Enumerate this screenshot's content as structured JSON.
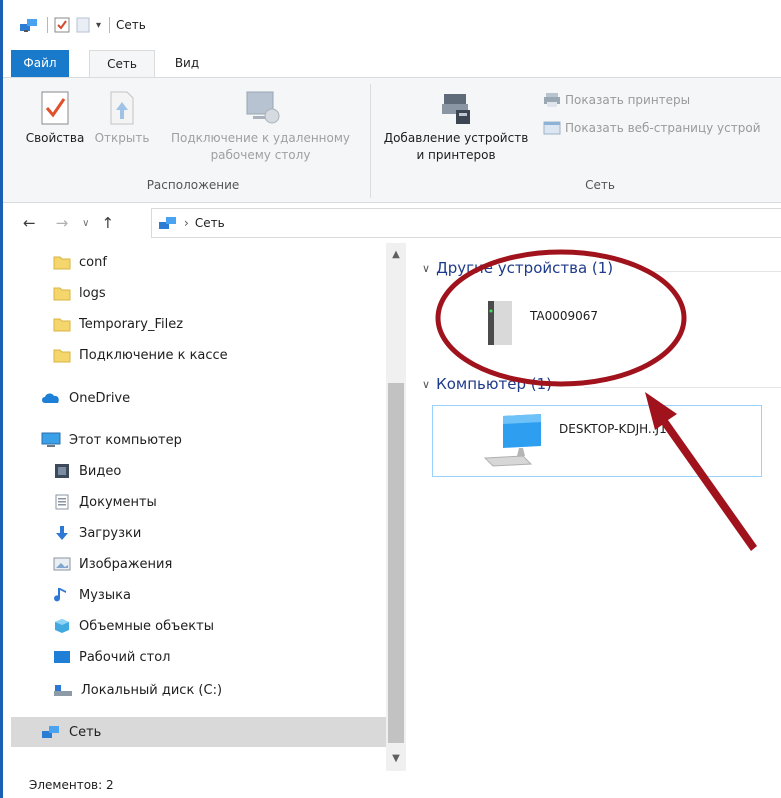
{
  "window": {
    "title": "Сеть"
  },
  "tabs": {
    "file": "Файл",
    "network": "Сеть",
    "view": "Вид"
  },
  "ribbon": {
    "properties": "Свойства",
    "open": "Открыть",
    "remote_line1": "Подключение к удаленному",
    "remote_line2": "рабочему столу",
    "location_group": "Расположение",
    "add_devices_line1": "Добавление устройств",
    "add_devices_line2": "и принтеров",
    "show_printers": "Показать принтеры",
    "show_webpage": "Показать веб-страницу устрой",
    "network_group": "Сеть"
  },
  "address": {
    "crumb": "Сеть"
  },
  "nav": {
    "items": [
      {
        "label": "conf",
        "icon": "folder-icon"
      },
      {
        "label": "logs",
        "icon": "folder-icon"
      },
      {
        "label": "Temporary_Filez",
        "icon": "folder-icon"
      },
      {
        "label": "Подключение к кассе",
        "icon": "folder-icon"
      },
      {
        "label": "OneDrive",
        "icon": "cloud-icon"
      },
      {
        "label": "Этот компьютер",
        "icon": "computer-icon"
      },
      {
        "label": "Видео",
        "icon": "video-icon"
      },
      {
        "label": "Документы",
        "icon": "documents-icon"
      },
      {
        "label": "Загрузки",
        "icon": "download-icon"
      },
      {
        "label": "Изображения",
        "icon": "pictures-icon"
      },
      {
        "label": "Музыка",
        "icon": "music-icon"
      },
      {
        "label": "Объемные объекты",
        "icon": "3d-objects-icon"
      },
      {
        "label": "Рабочий стол",
        "icon": "desktop-icon"
      },
      {
        "label": "Локальный диск (C:)",
        "icon": "drive-icon"
      },
      {
        "label": "Сеть",
        "icon": "network-icon"
      }
    ]
  },
  "content": {
    "other_devices_header": "Другие устройства (1)",
    "other_device_name": "TA0009067",
    "computers_header": "Компьютер (1)",
    "computer_name": "DESKTOP-KDJH..J1"
  },
  "status": {
    "items_count": "Элементов: 2"
  },
  "colors": {
    "accent": "#1979ca",
    "annotation": "#a0121c"
  }
}
